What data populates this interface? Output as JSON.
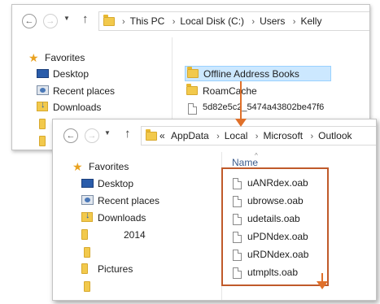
{
  "window_back": {
    "breadcrumb": [
      "This PC",
      "Local Disk (C:)",
      "Users",
      "Kelly"
    ],
    "nav_items": [
      "Favorites",
      "Desktop",
      "Recent places",
      "Downloads"
    ],
    "files": [
      "Offline Address Books",
      "RoamCache",
      "5d82e5c2_5474a43802be47f6"
    ]
  },
  "window_front": {
    "breadcrumb_prefix": "«",
    "breadcrumb": [
      "AppData",
      "Local",
      "Microsoft",
      "Outlook"
    ],
    "nav_items": [
      "Favorites",
      "Desktop",
      "Recent places",
      "Downloads",
      "2014",
      "Pictures"
    ],
    "column_header": "Name",
    "files": [
      "uANRdex.oab",
      "ubrowse.oab",
      "udetails.oab",
      "uPDNdex.oab",
      "uRDNdex.oab",
      "utmplts.oab"
    ]
  },
  "icons": {
    "back": "←",
    "forward": "→",
    "dropdown": "▼",
    "up": "↑",
    "star": "★"
  },
  "colors": {
    "highlight_border": "#c05a2a",
    "arrow": "#e0702a",
    "selection": "#cce8ff"
  }
}
